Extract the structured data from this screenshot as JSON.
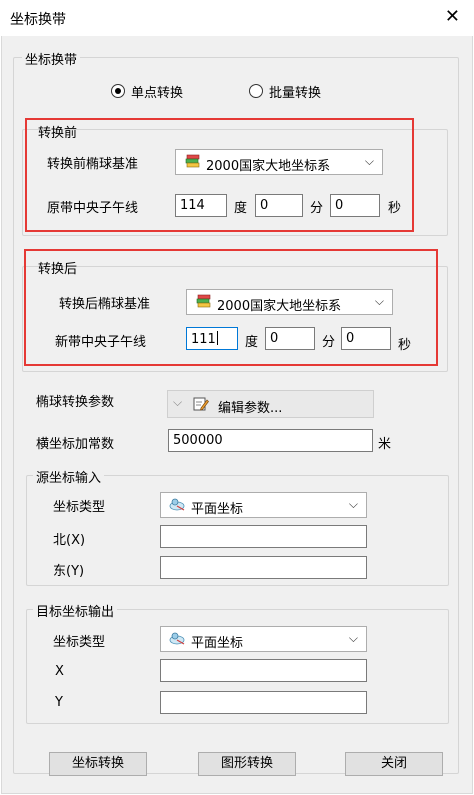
{
  "window": {
    "title": "坐标换带"
  },
  "group_main": {
    "label": "坐标换带"
  },
  "mode": {
    "single": "单点转换",
    "batch": "批量转换",
    "selected": "single"
  },
  "before": {
    "label": "转换前",
    "ellipsoid_label": "转换前椭球基准",
    "ellipsoid_value": "2000国家大地坐标系",
    "meridian_label": "原带中央子午线",
    "deg_value": "114",
    "deg_unit": "度",
    "min_value": "0",
    "min_unit": "分",
    "sec_value": "0",
    "sec_unit": "秒"
  },
  "after": {
    "label": "转换后",
    "ellipsoid_label": "转换后椭球基准",
    "ellipsoid_value": "2000国家大地坐标系",
    "meridian_label": "新带中央子午线",
    "deg_value": "111",
    "deg_unit": "度",
    "min_value": "0",
    "min_unit": "分",
    "sec_value": "0",
    "sec_unit": "秒"
  },
  "params": {
    "label": "椭球转换参数",
    "edit_label": "编辑参数...",
    "false_easting_label": "横坐标加常数",
    "false_easting_value": "500000",
    "false_easting_unit": "米"
  },
  "source": {
    "label": "源坐标输入",
    "type_label": "坐标类型",
    "type_value": "平面坐标",
    "north_label": "北(X)",
    "east_label": "东(Y)",
    "north_value": "",
    "east_value": ""
  },
  "target": {
    "label": "目标坐标输出",
    "type_label": "坐标类型",
    "type_value": "平面坐标",
    "x_label": "X",
    "y_label": "Y",
    "x_value": "",
    "y_value": ""
  },
  "buttons": {
    "convert": "坐标转换",
    "graphic": "图形转换",
    "close": "关闭"
  },
  "colors": {
    "highlight_box": "#e53935",
    "focus_border": "#0078d7"
  }
}
